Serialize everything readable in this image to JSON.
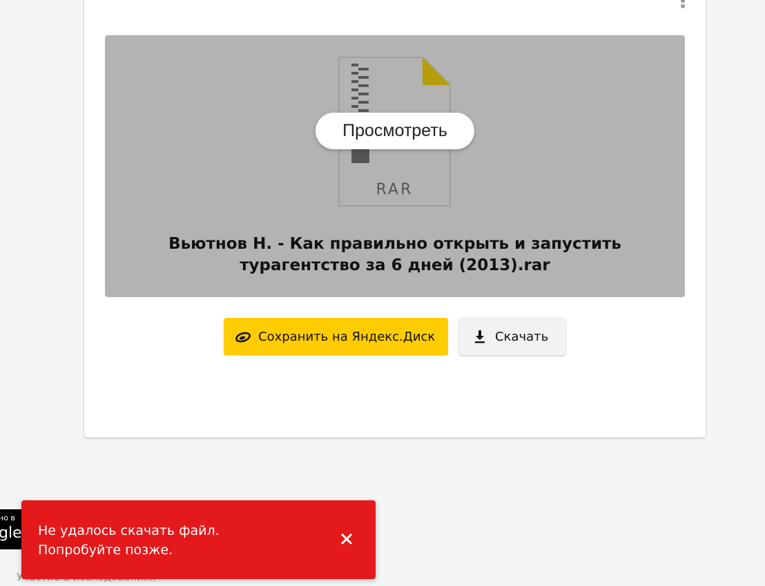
{
  "preview": {
    "view_label": "Просмотреть",
    "archive_type": "RAR",
    "file_name_line1": "Вьютнов Н. - Как правильно открыть и запустить",
    "file_name_line2": "турагентство за 6 дней (2013).rar"
  },
  "actions": {
    "save_label": "Сохранить на Яндекс.Диск",
    "download_label": "Скачать"
  },
  "promo": {
    "line1": "но в",
    "line2": "gle Play"
  },
  "footer": {
    "research_link": "Участие в исследованиях"
  },
  "toast": {
    "message": "Не удалось скачать файл. Попробуйте позже."
  },
  "colors": {
    "save_button": "#ffcc00",
    "toast_background": "#e3191b",
    "preview_background": "#b3b3b3"
  },
  "icons": {
    "more": "more-vertical-icon",
    "archive": "rar-archive-icon",
    "disk": "yandex-disk-icon",
    "download": "download-icon",
    "close": "close-icon"
  }
}
